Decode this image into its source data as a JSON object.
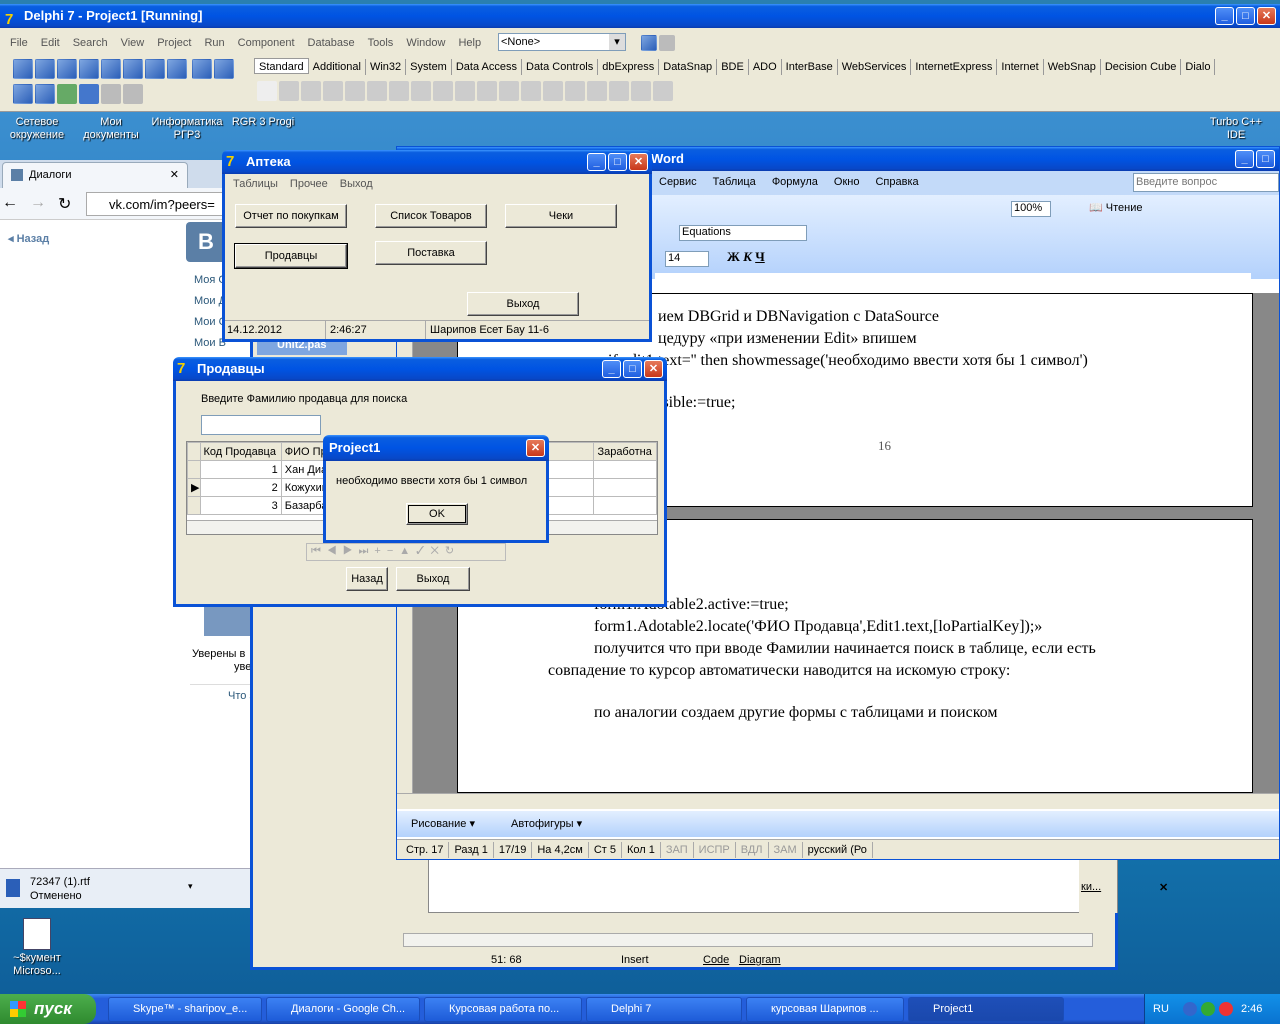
{
  "delphi": {
    "title": "Delphi 7 - Project1 [Running]",
    "menu": [
      "File",
      "Edit",
      "Search",
      "View",
      "Project",
      "Run",
      "Component",
      "Database",
      "Tools",
      "Window",
      "Help"
    ],
    "combo": "<None>",
    "tabs": [
      "Standard",
      "Additional",
      "Win32",
      "System",
      "Data Access",
      "Data Controls",
      "dbExpress",
      "DataSnap",
      "BDE",
      "ADO",
      "InterBase",
      "WebServices",
      "InternetExpress",
      "Internet",
      "WebSnap",
      "Decision Cube",
      "Dialo"
    ]
  },
  "desktop_icons": [
    {
      "label": "Сетевое окружение"
    },
    {
      "label": "Мои документы"
    },
    {
      "label": "Информатика РГР3"
    },
    {
      "label": "RGR 3 Progi"
    },
    {
      "label": "Turbo C++ IDE"
    },
    {
      "label": "~$кумент Microso..."
    }
  ],
  "browser": {
    "tab": "Диалоги",
    "back": "Назад",
    "url": "vk.com/im?peers=",
    "links": [
      "Моя С",
      "Мои Д",
      "Мои С",
      "Мои В"
    ],
    "msg1": "Уверены в",
    "msg2": "уверены",
    "msg3": "Что з",
    "download_name": "72347 (1).rtf",
    "download_status": "Отменено"
  },
  "apteka": {
    "title": "Аптека",
    "menu": [
      "Таблицы",
      "Прочее",
      "Выход"
    ],
    "btn_report": "Отчет по покупкам",
    "btn_list": "Список Товаров",
    "btn_checks": "Чеки",
    "btn_sellers": "Продавцы",
    "btn_supply": "Поставка",
    "btn_exit": "Выход",
    "status_date": "14.12.2012",
    "status_time": "2:46:27",
    "status_user": "Шарипов Есет Бау 11-6"
  },
  "sellers": {
    "title": "Продавцы",
    "prompt": "Введите Фамилию продавца для поиска",
    "columns": [
      "Код Продавца",
      "ФИО Пр",
      "Заработна"
    ],
    "rows": [
      {
        "id": "1",
        "name": "Хан Диа"
      },
      {
        "id": "2",
        "name": "Кожухин"
      },
      {
        "id": "3",
        "name": "Базарбае"
      }
    ],
    "btn_back": "Назад",
    "btn_exit": "Выход"
  },
  "dialog": {
    "title": "Project1",
    "message": "необходимо ввести хотя бы 1 символ",
    "ok": "OK"
  },
  "unit_tab": "Unit2.pas",
  "word": {
    "title": "Word",
    "menu": [
      "Сервис",
      "Таблица",
      "Формула",
      "Окно",
      "Справка"
    ],
    "ask": "Введите вопрос",
    "zoom": "100%",
    "read": "Чтение",
    "style": "Equations",
    "font_size": "14",
    "page_num": "16",
    "lines1": [
      "ием DBGrid и DBNavigation с DataSource",
      "цедуру «при изменении Edit» впишем",
      "if edit1.text='' then showmessage('необходимо ввести хотя бы 1 символ')",
      "isible:=true;"
    ],
    "lines2": [
      "form1.Adotable2.active:=true;",
      "form1.Adotable2.locate('ФИО Продавца',Edit1.text,[loPartialKey]);»",
      "получится что при вводе Фамилии начинается поиск в таблице, если есть",
      "совпадение то курсор автоматически наводится на искомую строку:",
      "по аналогии создаем другие формы с таблицами и поиском"
    ],
    "draw": "Рисование",
    "autoshapes": "Автофигуры",
    "status": [
      "Стр. 17",
      "Разд 1",
      "17/19",
      "На 4,2см",
      "Ст 5",
      "Кол 1",
      "ЗАП",
      "ИСПР",
      "ВДЛ",
      "ЗАМ",
      "русский (Ро"
    ]
  },
  "editor": {
    "pos": "51: 68",
    "mode": "Insert",
    "tab_code": "Code",
    "tab_diagram": "Diagram",
    "side_text": "ки..."
  },
  "taskbar": {
    "start": "пуск",
    "items": [
      "Skype™ - sharipov_e...",
      "Диалоги - Google Ch...",
      "Курсовая работа по...",
      "Delphi 7",
      "курсовая Шарипов ...",
      "Project1"
    ],
    "lang": "RU",
    "clock": "2:46"
  }
}
